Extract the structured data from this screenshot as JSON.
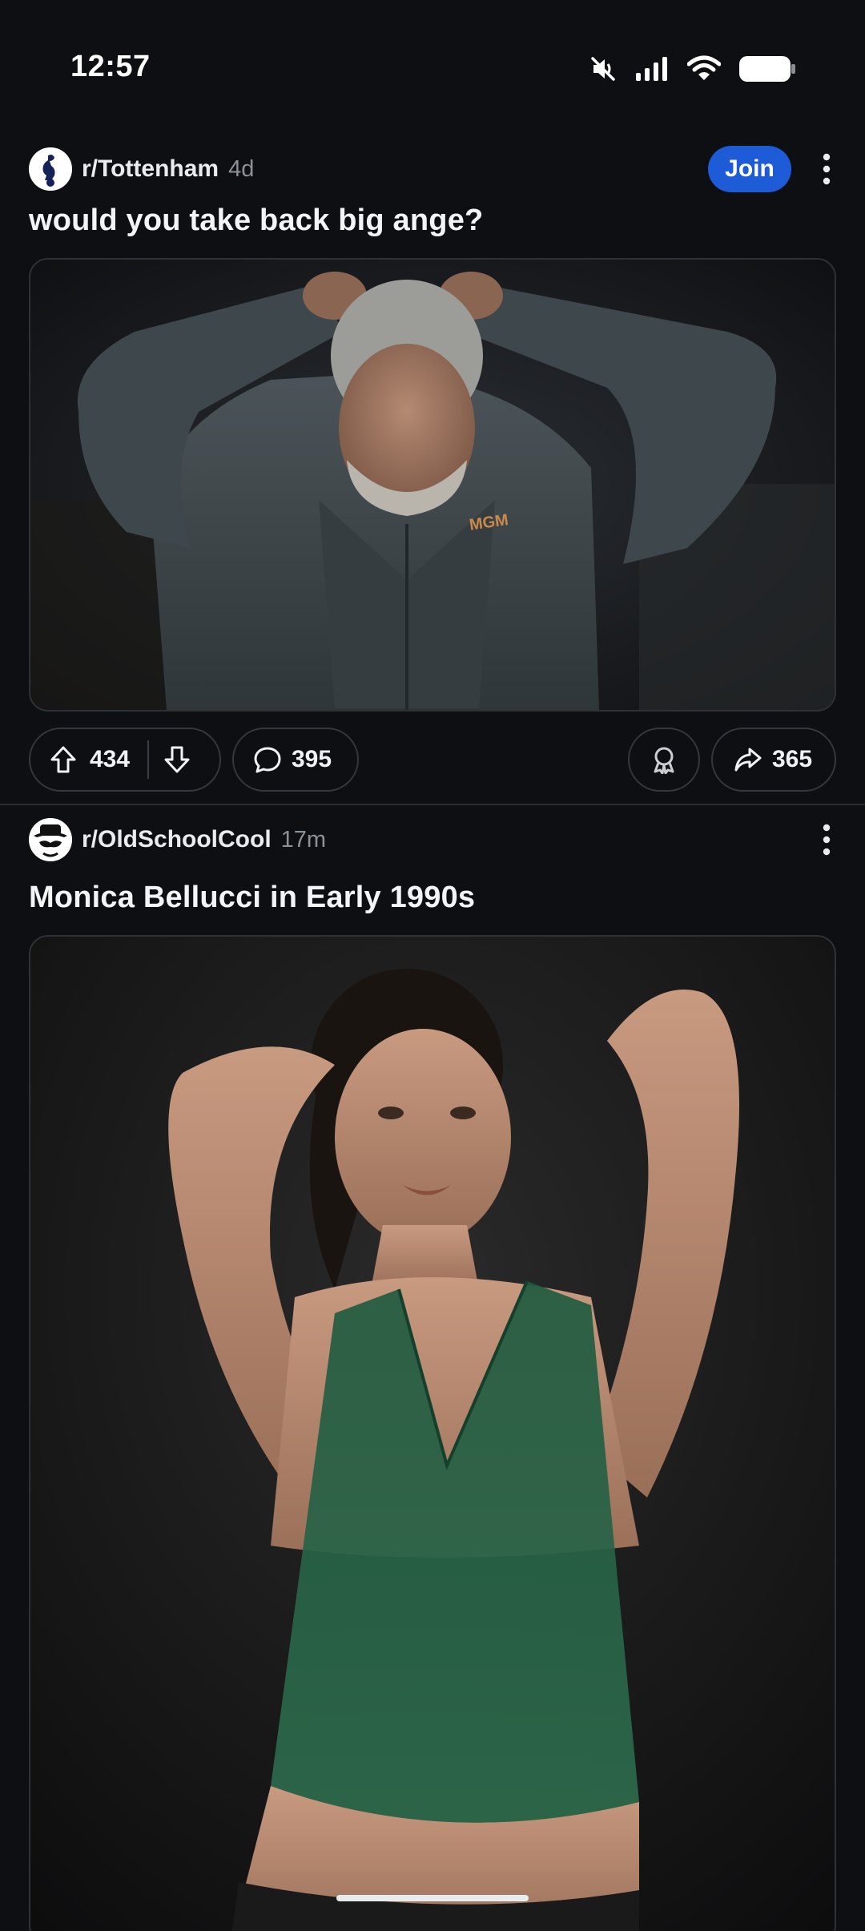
{
  "status_bar": {
    "time": "12:57",
    "icons": [
      "mute-icon",
      "signal-icon",
      "wifi-icon",
      "battery-icon"
    ]
  },
  "posts": [
    {
      "subreddit": "r/Tottenham",
      "age": "4d",
      "join_label": "Join",
      "title": "would you take back big ange?",
      "image_text": "MGM",
      "upvotes": "434",
      "comments": "395",
      "shares": "365"
    },
    {
      "subreddit": "r/OldSchoolCool",
      "age": "17m",
      "title": "Monica Bellucci in Early 1990s"
    }
  ],
  "colors": {
    "background": "#0e0f12",
    "join_button": "#1e5bd6",
    "muted_text": "#8b9199",
    "pill_border": "#34373d"
  }
}
